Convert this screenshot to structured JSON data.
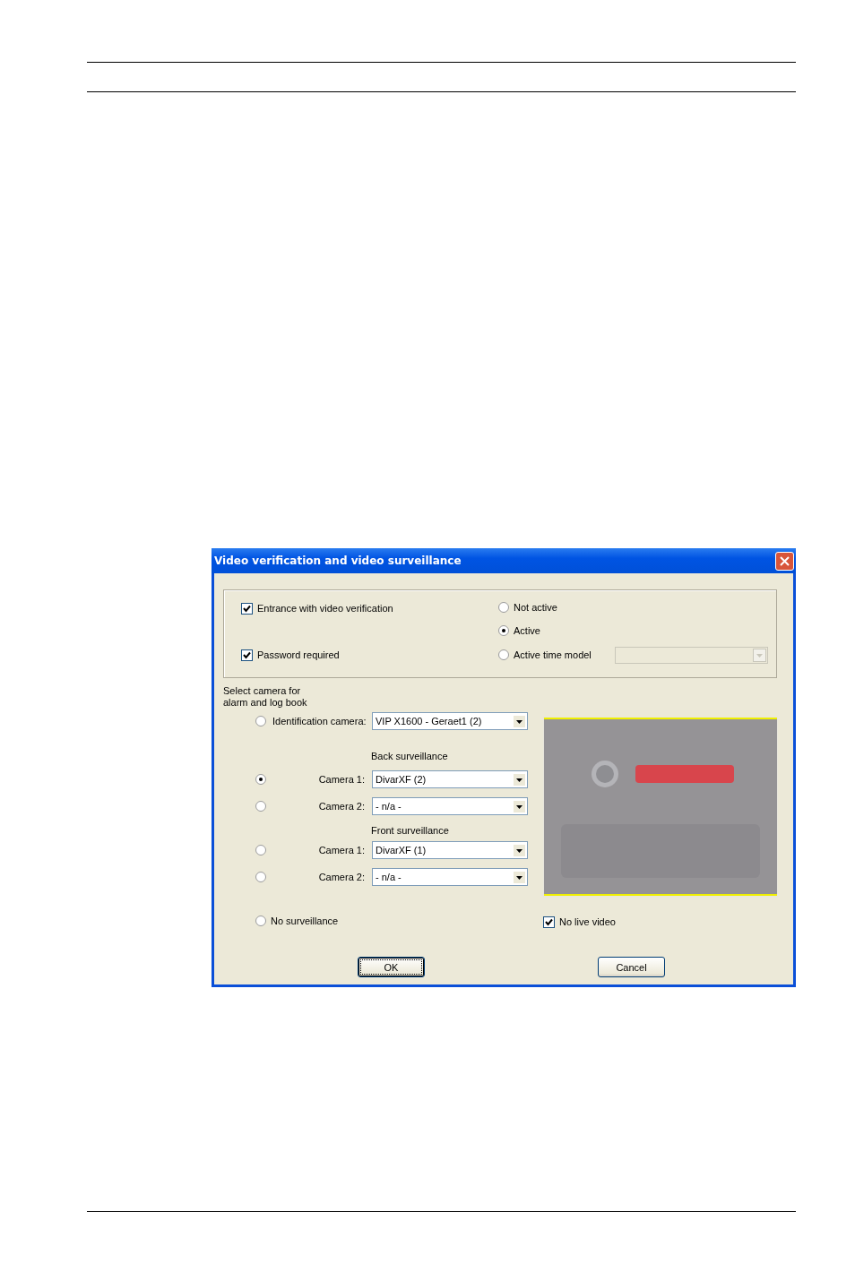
{
  "window": {
    "title": "Video verification and video surveillance"
  },
  "verification": {
    "checkboxes": [
      {
        "label": "Entrance with video verification",
        "checked": true
      },
      {
        "label": "Password required",
        "checked": true
      }
    ],
    "modes": [
      {
        "label": "Not active",
        "selected": false
      },
      {
        "label": "Active",
        "selected": true
      },
      {
        "label": "Active time model",
        "selected": false
      }
    ],
    "time_model_dropdown": {
      "disabled": true
    }
  },
  "camera_selection": {
    "heading": "Select camera for\nalarm and log book",
    "identification": {
      "label": "Identification camera:",
      "value": "VIP X1600 - Geraet1 (2)",
      "selected": false
    },
    "groups": [
      {
        "heading": "Back surveillance",
        "cameras": [
          {
            "label": "Camera 1:",
            "value": "DivarXF (2)",
            "selected": true
          },
          {
            "label": "Camera 2:",
            "value": "- n/a -",
            "selected": false
          }
        ]
      },
      {
        "heading": "Front surveillance",
        "cameras": [
          {
            "label": "Camera 1:",
            "value": "DivarXF (1)",
            "selected": false
          },
          {
            "label": "Camera 2:",
            "value": "- n/a -",
            "selected": false
          }
        ]
      }
    ],
    "no_surveillance": {
      "label": "No surveillance",
      "selected": false
    }
  },
  "no_live_video": {
    "label": "No live video",
    "checked": true
  },
  "buttons": [
    {
      "label": "OK",
      "default": true
    },
    {
      "label": "Cancel",
      "default": false
    }
  ]
}
